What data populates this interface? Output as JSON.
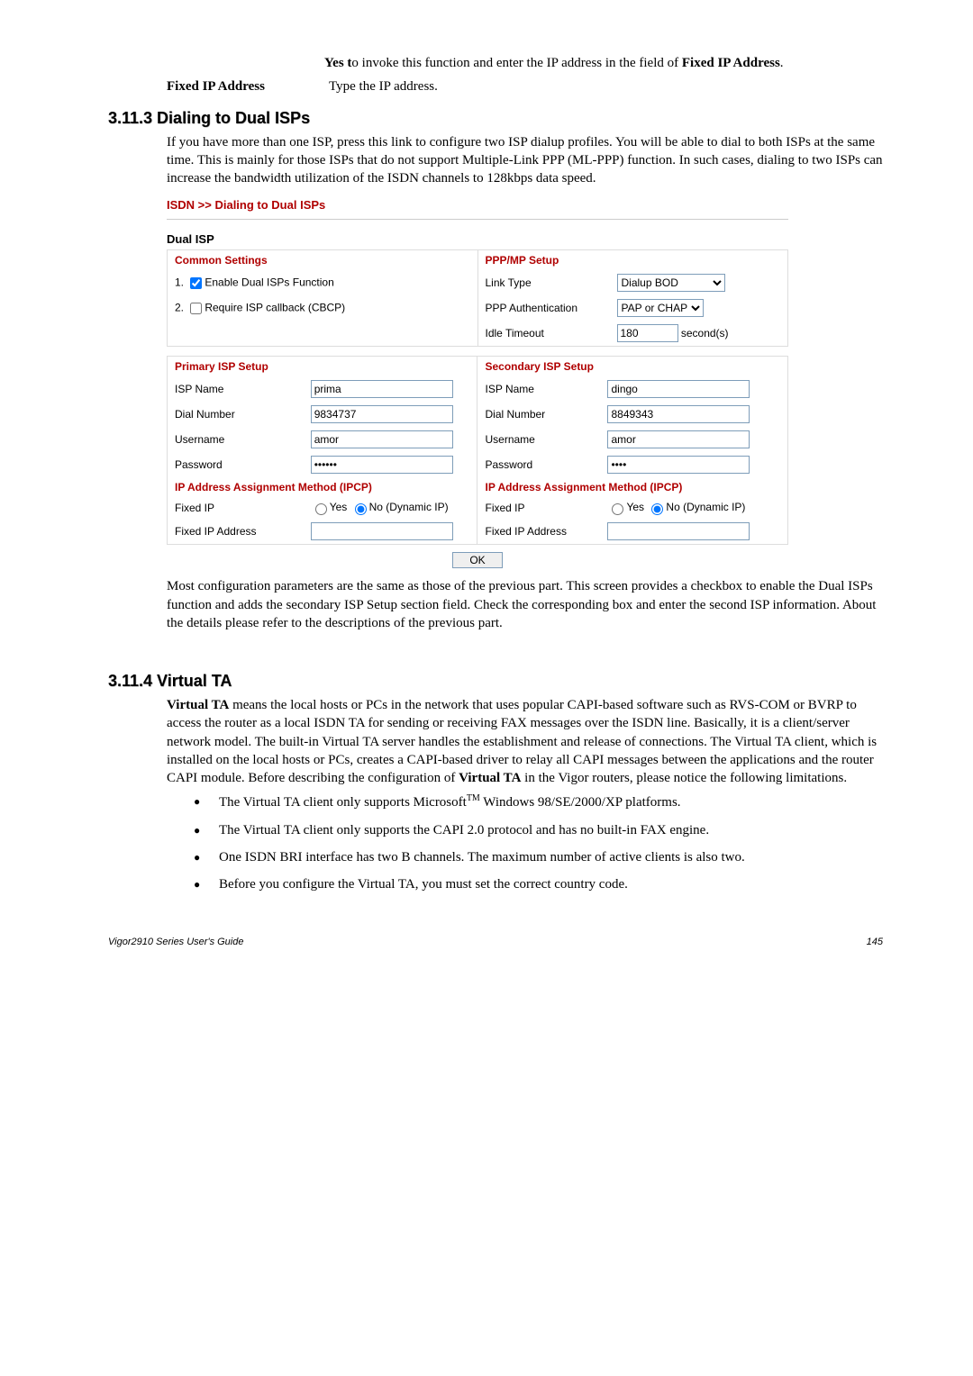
{
  "top": {
    "yes_line": "Yes to invoke this function and enter the IP address in the field of Fixed IP Address.",
    "fixed_ip_label": "Fixed IP Address",
    "fixed_ip_desc": "Type the IP address."
  },
  "sec1": {
    "heading": "3.11.3 Dialing to Dual ISPs",
    "para1": "If you have more than one ISP, press this link to configure two ISP dialup profiles. You will be able to dial to both ISPs at the same time. This is mainly for those ISPs that do not support Multiple-Link PPP (ML-PPP) function. In such cases, dialing to two ISPs can increase the bandwidth utilization of the ISDN channels to 128kbps data speed.",
    "para2": "Most configuration parameters are the same as those of the previous part. This screen provides a checkbox to enable the Dual ISPs function and adds the secondary ISP Setup section field. Check the corresponding box and enter the second ISP information. About the details please refer to the descriptions of the previous part."
  },
  "ui": {
    "breadcrumb": "ISDN >> Dialing to Dual ISPs",
    "block_title": "Dual ISP",
    "common_settings": "Common Settings",
    "enable_dual": "Enable Dual ISPs Function",
    "require_cbcp": "Require ISP callback (CBCP)",
    "ppp_mp_setup": "PPP/MP Setup",
    "link_type": "Link Type",
    "link_type_val": "Dialup BOD",
    "ppp_auth": "PPP Authentication",
    "ppp_auth_val": "PAP or CHAP",
    "idle_timeout": "Idle Timeout",
    "idle_timeout_val": "180",
    "seconds": "second(s)",
    "primary_setup": "Primary ISP Setup",
    "secondary_setup": "Secondary ISP Setup",
    "isp_name": "ISP Name",
    "dial_number": "Dial Number",
    "username": "Username",
    "password": "Password",
    "ipcp": "IP Address Assignment Method (IPCP)",
    "fixed_ip": "Fixed IP",
    "yes": "Yes",
    "no_dyn": "No (Dynamic IP)",
    "fixed_ip_addr": "Fixed IP Address",
    "primary": {
      "isp_name": "prima",
      "dial": "9834737",
      "user": "amor",
      "pass": "••••••"
    },
    "secondary": {
      "isp_name": "dingo",
      "dial": "8849343",
      "user": "amor",
      "pass": "••••"
    },
    "ok": "OK"
  },
  "sec2": {
    "heading": "3.11.4 Virtual TA",
    "para_pre": "Virtual TA",
    "para": " means the local hosts or PCs in the network that uses popular CAPI-based software such as RVS-COM or BVRP to access the router as a local ISDN TA for sending or receiving FAX messages over the ISDN line. Basically, it is a client/server network model. The built-in Virtual TA server handles the establishment and release of connections. The Virtual TA client, which is installed on the local hosts or PCs, creates a CAPI-based driver to relay all CAPI messages between the applications and the router CAPI module. Before describing the configuration of ",
    "para_mid_bold": "Virtual TA",
    "para_end": " in the Vigor routers, please notice the following limitations.",
    "bullet1a": "The Virtual TA client only supports Microsoft",
    "bullet1b": " Windows 98/SE/2000/XP platforms.",
    "bullet2": "The Virtual TA client only supports the CAPI 2.0 protocol and has no built-in FAX engine.",
    "bullet3": "One ISDN BRI interface has two B channels. The maximum number of active clients is also two.",
    "bullet4": "Before you configure the Virtual TA, you must set the correct country code."
  },
  "footer": {
    "left": "Vigor2910 Series User's Guide",
    "right": "145"
  }
}
